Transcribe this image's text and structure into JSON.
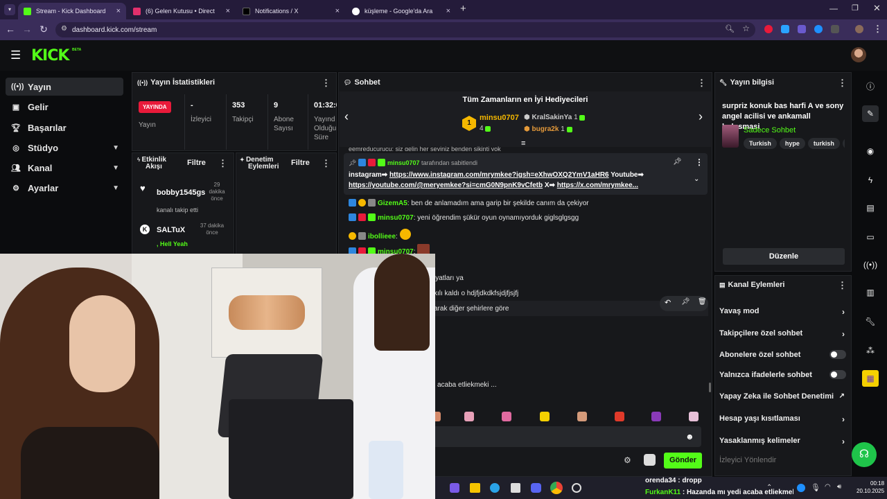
{
  "browser": {
    "tabs": [
      {
        "title": "Stream - Kick Dashboard",
        "favicon_color": "#53fc18",
        "active": true
      },
      {
        "title": "(6) Gelen Kutusu • Direct",
        "favicon_color": "#e1306c",
        "active": false
      },
      {
        "title": "Notifications / X",
        "favicon_color": "#000000",
        "active": false
      },
      {
        "title": "küşleme - Google'da Ara",
        "favicon_color": "#ffffff",
        "active": false
      }
    ],
    "url": "dashboard.kick.com/stream"
  },
  "kick": {
    "logo": "KICK",
    "beta": "BETA"
  },
  "sidebar": {
    "items": [
      {
        "label": "Yayın",
        "icon": "broadcast-icon"
      },
      {
        "label": "Gelir",
        "icon": "wallet-icon"
      },
      {
        "label": "Başarılar",
        "icon": "trophy-icon"
      },
      {
        "label": "Stüdyo",
        "icon": "studio-icon"
      },
      {
        "label": "Kanal",
        "icon": "people-icon"
      },
      {
        "label": "Ayarlar",
        "icon": "gear-icon"
      }
    ]
  },
  "stats": {
    "title": "Yayın İstatistikleri",
    "live_badge": "YAYINDA",
    "live_label": "Yayın",
    "viewers_value": "-",
    "viewers_label": "İzleyici",
    "followers_value": "353",
    "followers_label": "Takipçi",
    "subs_value": "9",
    "subs_label1": "Abone",
    "subs_label2": "Sayısı",
    "uptime_value": "01:32:0",
    "uptime_label1": "Yayınd",
    "uptime_label2": "Olduğu",
    "uptime_label3": "Süre"
  },
  "activity": {
    "title1": "Etkinlik",
    "title2": "Akışı",
    "filter": "Filtre",
    "items": [
      {
        "user": "bobby1545gs",
        "time1": "29",
        "time2": "dakika",
        "time3": "önce",
        "text": "kanalı takip etti"
      },
      {
        "user": "SALTuX",
        "time1": "37 dakika",
        "time2": "önce",
        "text": ", Hell Yeah"
      }
    ]
  },
  "moderation": {
    "title1": "Denetim",
    "title2": "Eylemleri",
    "filter": "Filtre"
  },
  "chat": {
    "title": "Sohbet",
    "top_gifters_title": "Tüm Zamanların en İyi Hediyecileri",
    "gifters": [
      {
        "rank": "1",
        "name": "minsu0707",
        "count": "4"
      },
      {
        "name": "KralSakinYa",
        "count": "1"
      },
      {
        "name": "bugra2k",
        "count": "1"
      }
    ],
    "clipped_line": "eemreducurucu: siz gelin her şeyiniz benden sikinti yok",
    "pinned_by_user": "minsu0707",
    "pinned_by_text": "tarafından sabitlendi",
    "pinned_text_1a": "instagram➡",
    "pinned_link_1": "https://www.instagram.com/mrymkee?igsh=eXhwOXQ2YmV1aHR6",
    "pinned_text_1b": "Youtube➡",
    "pinned_link_2": "https://youtube.com/@meryemkee?si=cmG0N9pnK9vCfetb",
    "pinned_text_2b": "X➡",
    "pinned_link_3": "https://x.com/mrymkee...",
    "messages": [
      {
        "user": "GizemA5",
        "text": "ben de anlamadım ama garip bir şekilde canım da çekiyor"
      },
      {
        "user": "minsu0707",
        "text": "yeni öğrendim şükür oyun oynamıyorduk giglsglgsgg"
      },
      {
        "user": "ibollieee",
        "text": ""
      },
      {
        "user": "minsu0707",
        "text": ""
      }
    ],
    "partial_1": "iyatları ya",
    "partial_2": "kılı kaldı o hdjfjdkdkfsjdjfjsjfj",
    "partial_3": "arak diğer şehirlere göre",
    "partial_4": "i acaba etliekmeki ...",
    "send": "Gönder"
  },
  "stream_info": {
    "title": "Yayın bilgisi",
    "stream_title": "surpriz konuk bas harfi A ve sony angel acilisi ve ankamall bulusmasi",
    "category": "Sadece Sohbet",
    "tags": [
      "Turkish",
      "hype",
      "turkish",
      "fo"
    ],
    "edit": "Düzenle"
  },
  "channel_actions": {
    "title": "Kanal Eylemleri",
    "items": [
      {
        "label": "Yavaş mod",
        "kind": "chevron"
      },
      {
        "label": "Takipçilere özel sohbet",
        "kind": "chevron"
      },
      {
        "label": "Abonelere özel sohbet",
        "kind": "toggle"
      },
      {
        "label": "Yalnızca ifadelerle sohbet",
        "kind": "toggle"
      },
      {
        "label": "Yapay Zeka ile Sohbet Denetimi",
        "kind": "external"
      },
      {
        "label": "Hesap yaşı kısıtlaması",
        "kind": "chevron"
      },
      {
        "label": "Yasaklanmış kelimeler",
        "kind": "chevron"
      }
    ],
    "faded": "İzleyici Yönlendir"
  },
  "taskbar": {
    "ticker_1": "orenda34 : dropp",
    "ticker_2_user": "FurkanK11",
    "ticker_2_text": ": Hazanda mı yedi acaba etliekmek...",
    "time": "00:18",
    "date": "20.10.2025"
  },
  "colors": {
    "accent": "#53fc18",
    "live": "#e91a3a",
    "panel": "#17181b"
  }
}
